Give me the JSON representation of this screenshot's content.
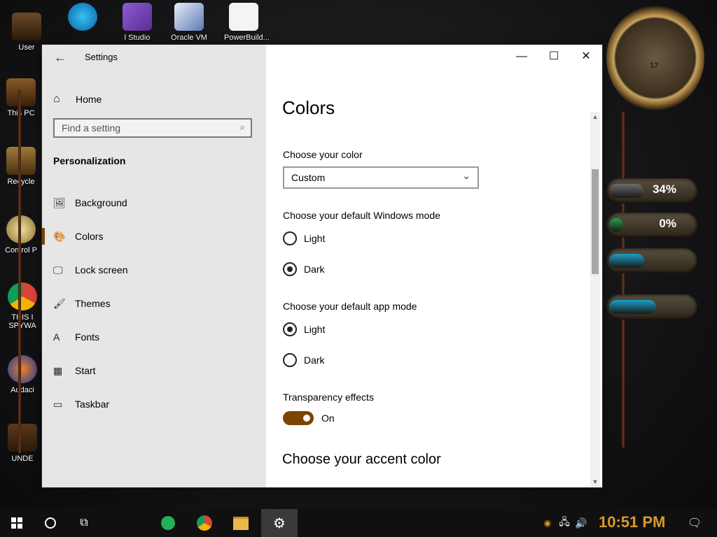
{
  "desktop": {
    "icons": [
      {
        "label": "User"
      },
      {
        "label": "This PC"
      },
      {
        "label": "Recycle"
      },
      {
        "label": "Control P"
      },
      {
        "label": "THIS I SPYWA"
      },
      {
        "label": "Audaci"
      },
      {
        "label": "UNDE"
      }
    ],
    "top_icons": [
      {
        "label": ""
      },
      {
        "label": "l Studio"
      },
      {
        "label": "Oracle VM"
      },
      {
        "label": "PowerBuild..."
      }
    ],
    "gauges": [
      {
        "percent": "34%",
        "level": 0.34,
        "color": "#6b6b6b"
      },
      {
        "percent": "0%",
        "level": 0.0,
        "color": "#2aa04a"
      },
      {
        "percent": "",
        "level": 0.35,
        "color": "#1aa0c8"
      },
      {
        "percent": "",
        "level": 0.55,
        "color": "#1aa0c8"
      }
    ],
    "clock_face": {
      "day": "17"
    }
  },
  "window": {
    "title": "Settings",
    "back_icon": "arrow-left-icon",
    "controls": {
      "minimize": "—",
      "maximize": "☐",
      "close": "✕"
    }
  },
  "sidebar": {
    "home_label": "Home",
    "search_placeholder": "Find a setting",
    "section_title": "Personalization",
    "items": [
      {
        "label": "Background",
        "icon": "image-icon",
        "glyph": "🖼"
      },
      {
        "label": "Colors",
        "icon": "palette-icon",
        "glyph": "🎨"
      },
      {
        "label": "Lock screen",
        "icon": "lock-screen-icon",
        "glyph": "🖵"
      },
      {
        "label": "Themes",
        "icon": "themes-icon",
        "glyph": "🖌"
      },
      {
        "label": "Fonts",
        "icon": "fonts-icon",
        "glyph": "A"
      },
      {
        "label": "Start",
        "icon": "start-icon",
        "glyph": "▦"
      },
      {
        "label": "Taskbar",
        "icon": "taskbar-icon",
        "glyph": "▭"
      }
    ],
    "active_item": "Colors"
  },
  "content": {
    "page_title": "Colors",
    "choose_color_label": "Choose your color",
    "choose_color_value": "Custom",
    "windows_mode_label": "Choose your default Windows mode",
    "windows_mode_options": [
      "Light",
      "Dark"
    ],
    "windows_mode_selected": "Dark",
    "app_mode_label": "Choose your default app mode",
    "app_mode_options": [
      "Light",
      "Dark"
    ],
    "app_mode_selected": "Light",
    "transparency_label": "Transparency effects",
    "transparency_state": "On",
    "accent_title": "Choose your accent color"
  },
  "taskbar": {
    "time": "10:51 PM",
    "accent": "#d79a2a"
  },
  "colors": {
    "accent": "#7a4500"
  }
}
